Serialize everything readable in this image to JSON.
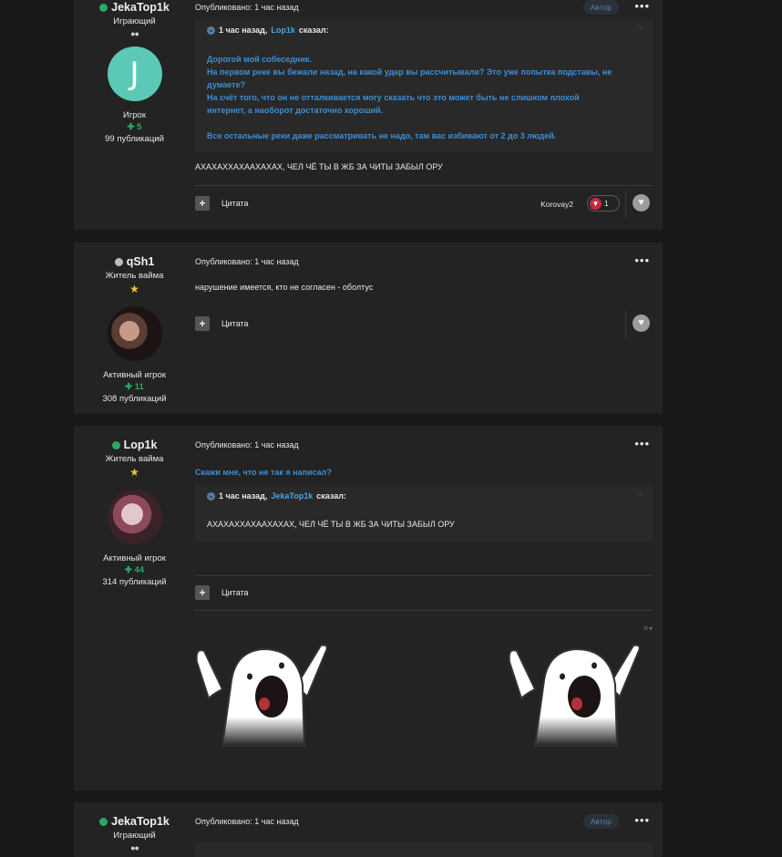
{
  "posts": [
    {
      "username": "JekaTop1k",
      "status": "online",
      "title": "Играющий",
      "rank_glyph": "●●",
      "avatar_letter": "J",
      "group": "Игрок",
      "reputation": "5",
      "publications": "99 публикаций",
      "posted": "Опубликовано: 1 час назад",
      "author_badge": "Автор",
      "more": "•••",
      "quote": {
        "time_prefix": "1 час назад,",
        "user": "Lop1k",
        "said": "сказал:",
        "lines": [
          "Дорогой мой собеседник.",
          "На первом реке вы бежали назад, на какой удар вы рассчитывали? Это уже попытка подставы, не",
          "думаете?",
          "На счёт того, что он не отталкивается могу сказать что это может быть не слишком плохой",
          "интернет, а наоборот достаточно хороший.",
          "",
          "Все остальные реки даже рассматривать не надо, там вас избивают от 2 до 3 людей."
        ]
      },
      "text": "АХАХАХХАХААХАХАХ, ЧЕЛ ЧЁ ТЫ В ЖБ ЗА ЧИТЫ ЗАБЫЛ ОРУ",
      "quote_button": "Цитата",
      "reactor": "Korovay2",
      "reaction_count": "1"
    },
    {
      "username": "qSh1",
      "status": "offline",
      "title": "Житель вайма",
      "group": "Активный игрок",
      "reputation": "11",
      "publications": "308 публикаций",
      "posted": "Опубликовано: 1 час назад",
      "more": "•••",
      "text": "нарушение имеется, кто не согласен - оболтус",
      "quote_button": "Цитата"
    },
    {
      "username": "Lop1k",
      "status": "online",
      "title": "Житель вайма",
      "group": "Активный игрок",
      "reputation": "44",
      "publications": "314 публикаций",
      "posted": "Опубликовано: 1 час назад",
      "more": "•••",
      "text": "Скажи мне, что не так я написал?",
      "quote": {
        "time_prefix": "1 час назад,",
        "user": "JekaTop1k",
        "said": "сказал:",
        "text": "АХАХАХХАХААХАХАХ, ЧЕЛ ЧЁ ТЫ В ЖБ ЗА ЧИТЫ ЗАБЫЛ ОРУ"
      },
      "quote_button": "Цитата",
      "image_controls": "✕▾"
    },
    {
      "username": "JekaTop1k",
      "status": "online",
      "title": "Играющий",
      "rank_glyph": "●●",
      "posted": "Опубликовано: 1 час назад",
      "author_badge": "Автор",
      "more": "•••"
    }
  ]
}
